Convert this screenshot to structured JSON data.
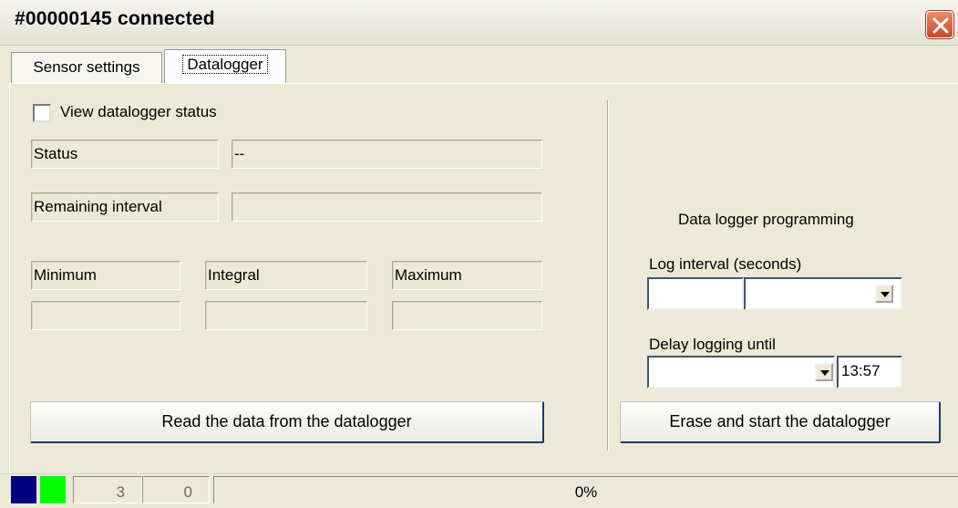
{
  "window": {
    "title": "#00000145 connected"
  },
  "tabs": [
    {
      "label": "Sensor settings"
    },
    {
      "label": "Datalogger"
    }
  ],
  "status_view": {
    "checkbox_label": "View datalogger status",
    "checked": false,
    "status_label": "Status",
    "status_value": "--",
    "remaining_label": "Remaining interval",
    "remaining_value": "",
    "minimum_label": "Minimum",
    "integral_label": "Integral",
    "maximum_label": "Maximum",
    "minimum_value": "",
    "integral_value": "",
    "maximum_value": "",
    "read_button": "Read the data from the datalogger"
  },
  "programming": {
    "heading": "Data logger programming",
    "log_interval_label": "Log interval (seconds)",
    "log_interval_value": "",
    "log_interval_select": "",
    "delay_label": "Delay logging until",
    "delay_date": "",
    "delay_time": "13:57",
    "start_button": "Erase and start the datalogger"
  },
  "statusbar": {
    "indicator1_color": "#000080",
    "indicator2_color": "#00ff00",
    "count1": "3",
    "count2": "0",
    "progress_text": "0%",
    "progress_fraction": 0
  }
}
